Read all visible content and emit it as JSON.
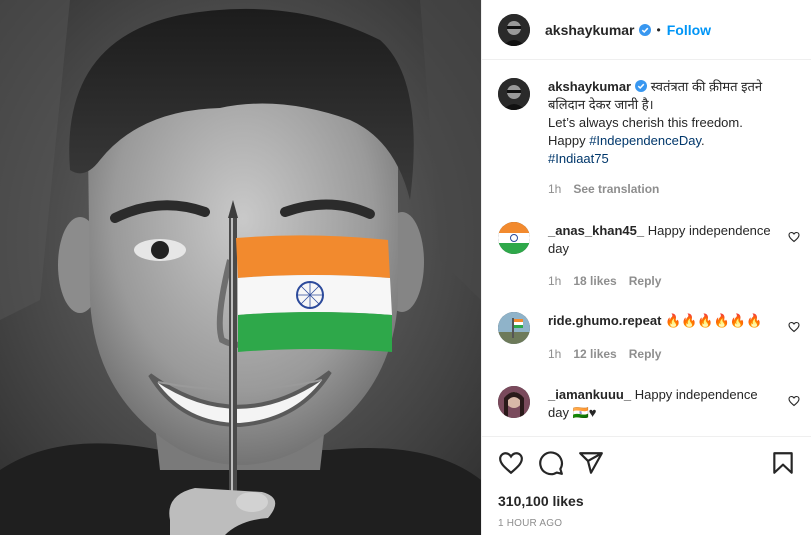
{
  "post": {
    "username": "akshaykumar",
    "separator": "•",
    "follow_label": "Follow"
  },
  "caption": {
    "username": "akshaykumar",
    "hindi_text": "स्वतंत्रता की क़ीमत इतने बलिदान देकर जानी है।",
    "line2": "Let’s always cherish this freedom.",
    "line3_prefix": "Happy ",
    "hashtag1": "#IndependenceDay",
    "line3_suffix": ".",
    "hashtag2": "#Indiaat75",
    "time": "1h",
    "see_translation": "See translation"
  },
  "comments": [
    {
      "username": "_anas_khan45_",
      "text": "Happy independence day",
      "time": "1h",
      "likes": "18 likes",
      "reply": "Reply"
    },
    {
      "username": "ride.ghumo.repeat",
      "text": "🔥🔥🔥🔥🔥🔥",
      "time": "1h",
      "likes": "12 likes",
      "reply": "Reply"
    },
    {
      "username": "_iamankuuu_",
      "text": "Happy independence day 🇮🇳♥"
    }
  ],
  "stats": {
    "likes": "310,100 likes",
    "posted": "1 HOUR AGO"
  },
  "colors": {
    "link_blue": "#0095f6",
    "hashtag": "#00376b",
    "muted": "#8e8e8e",
    "saffron": "#f28a2e",
    "flag_green": "#2ea84a",
    "chakra": "#2c4a9b"
  },
  "icons": [
    "verified-badge-icon",
    "heart-icon",
    "comment-icon",
    "share-icon",
    "bookmark-icon"
  ]
}
